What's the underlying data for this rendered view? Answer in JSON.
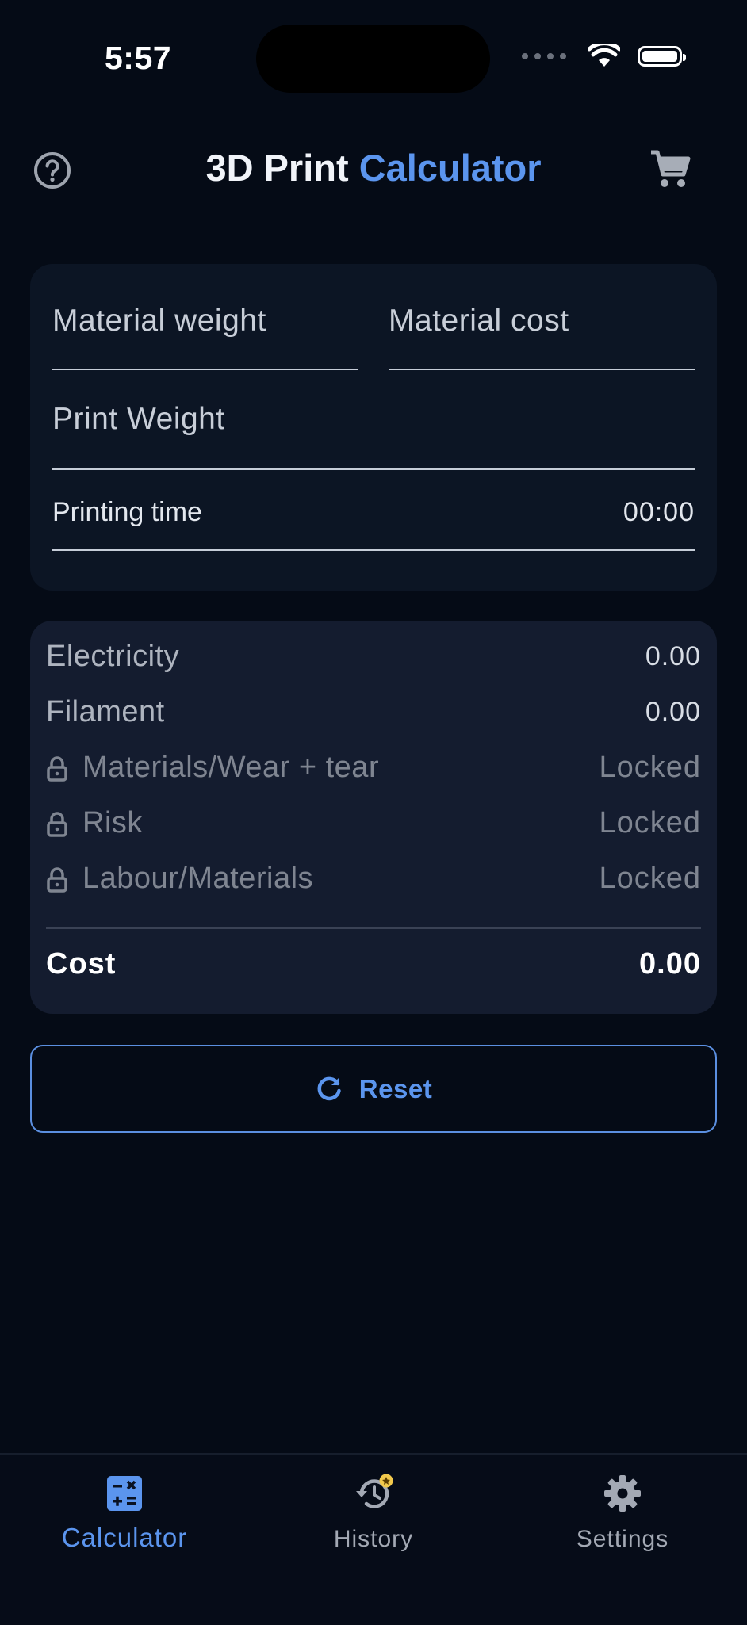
{
  "status_bar": {
    "time": "5:57"
  },
  "header": {
    "title_main": "3D Print ",
    "title_accent": "Calculator",
    "help_icon": "question-circle-icon",
    "cart_icon": "shopping-cart-icon"
  },
  "inputs": {
    "material_weight_label": "Material weight",
    "material_cost_label": "Material cost",
    "print_weight_label": "Print Weight",
    "printing_time_label": "Printing time",
    "printing_time_value": "00:00"
  },
  "breakdown": {
    "rows": [
      {
        "label": "Electricity",
        "value": "0.00",
        "locked": false
      },
      {
        "label": "Filament",
        "value": "0.00",
        "locked": false
      },
      {
        "label": "Materials/Wear + tear",
        "value": "Locked",
        "locked": true
      },
      {
        "label": "Risk",
        "value": "Locked",
        "locked": true
      },
      {
        "label": "Labour/Materials",
        "value": "Locked",
        "locked": true
      }
    ],
    "total_label": "Cost",
    "total_value": "0.00"
  },
  "reset": {
    "label": "Reset",
    "icon": "refresh-icon"
  },
  "tabbar": {
    "tabs": [
      {
        "label": "Calculator",
        "icon": "calculator-icon",
        "active": true
      },
      {
        "label": "History",
        "icon": "history-icon",
        "active": false
      },
      {
        "label": "Settings",
        "icon": "gear-icon",
        "active": false
      }
    ]
  },
  "colors": {
    "background": "#050b16",
    "card": "#0c1524",
    "breakdown_card": "#141c2f",
    "accent": "#5b95ee",
    "badge": "#f2c94c"
  }
}
